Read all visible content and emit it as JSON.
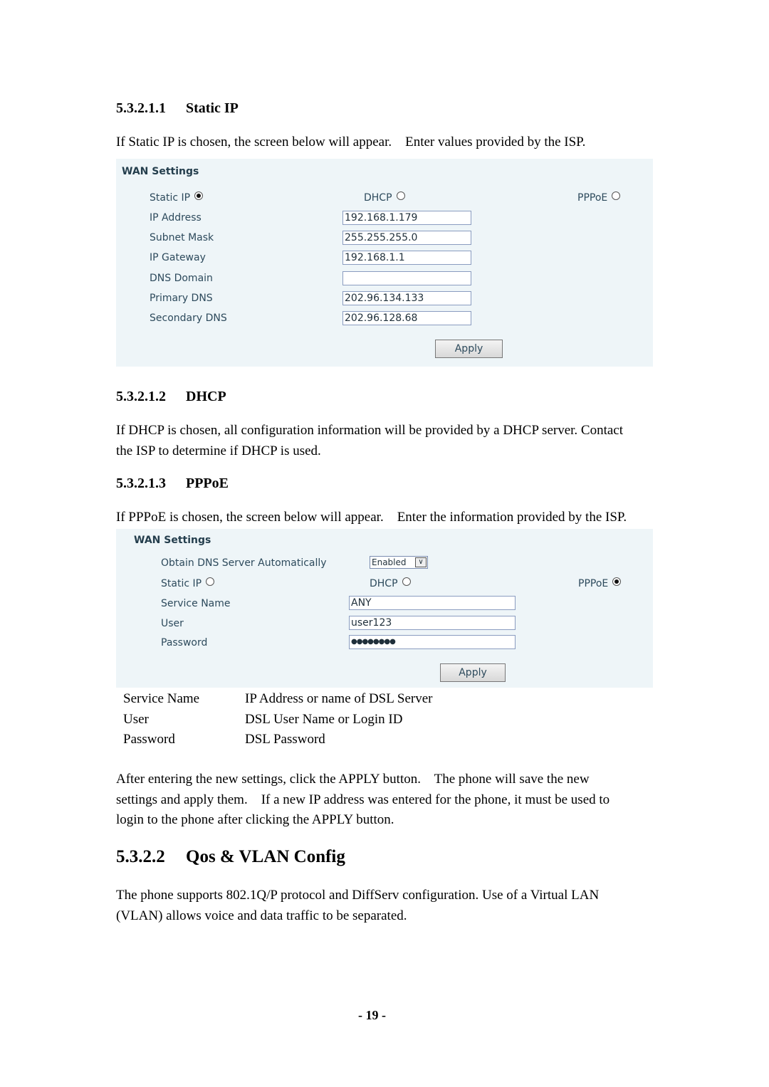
{
  "sections": {
    "static_ip": {
      "num": "5.3.2.1.1",
      "title": "Static IP",
      "text": "If Static IP is chosen, the screen below will appear.    Enter values provided by the ISP."
    },
    "dhcp": {
      "num": "5.3.2.1.2",
      "title": "DHCP",
      "text": [
        "If DHCP is chosen, all configuration information will be provided by a DHCP server. Contact",
        "the ISP to determine if DHCP is used."
      ]
    },
    "pppoe": {
      "num": "5.3.2.1.3",
      "title": "PPPoE",
      "text": "If PPPoE is chosen, the screen below will appear.    Enter the information provided by the ISP."
    },
    "qos": {
      "num": "5.3.2.2",
      "title": "Qos & VLAN Config",
      "text": [
        "The phone supports 802.1Q/P protocol and DiffServ configuration. Use of a Virtual LAN",
        "(VLAN) allows voice and data traffic to be separated."
      ]
    }
  },
  "panel1": {
    "title": "WAN Settings",
    "radios": [
      {
        "label": "Static IP",
        "checked": true
      },
      {
        "label": "DHCP",
        "checked": false
      },
      {
        "label": "PPPoE",
        "checked": false
      }
    ],
    "fields": [
      {
        "label": "IP Address",
        "value": "192.168.1.179"
      },
      {
        "label": "Subnet Mask",
        "value": "255.255.255.0"
      },
      {
        "label": "IP Gateway",
        "value": "192.168.1.1"
      },
      {
        "label": "DNS Domain",
        "value": ""
      },
      {
        "label": "Primary DNS",
        "value": "202.96.134.133"
      },
      {
        "label": "Secondary DNS",
        "value": "202.96.128.68"
      }
    ],
    "apply": "Apply"
  },
  "panel2": {
    "title": "WAN Settings",
    "dns_label": "Obtain DNS Server Automatically",
    "dns_value": "Enabled",
    "radios": [
      {
        "label": "Static IP",
        "checked": false
      },
      {
        "label": "DHCP",
        "checked": false
      },
      {
        "label": "PPPoE",
        "checked": true
      }
    ],
    "fields": [
      {
        "label": "Service Name",
        "value": "ANY"
      },
      {
        "label": "User",
        "value": "user123"
      },
      {
        "label": "Password",
        "value": "●●●●●●●●"
      }
    ],
    "apply": "Apply"
  },
  "defs": [
    {
      "term": "Service Name",
      "desc": "IP Address or name of DSL Server"
    },
    {
      "term": "User",
      "desc": "DSL User Name or Login ID"
    },
    {
      "term": "Password",
      "desc": "DSL Password"
    }
  ],
  "after_text": [
    "After entering the new settings, click the APPLY button.    The phone will save the new",
    "settings and apply them.    If a new IP address was entered for the phone, it must be used to",
    "login to the phone after clicking the APPLY button."
  ],
  "page_number": "- 19 -",
  "colors": {
    "panel_bg": "#eef5f8",
    "panel_text": "#2d4a5c"
  }
}
